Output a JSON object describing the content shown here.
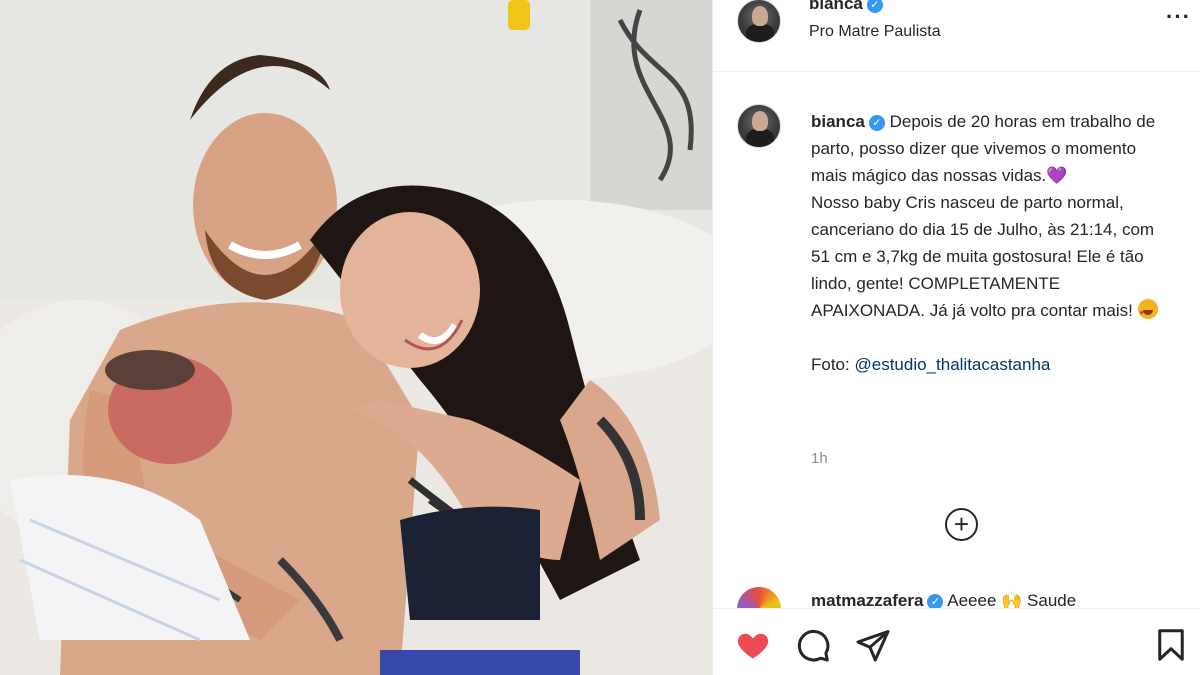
{
  "post": {
    "header": {
      "username": "bianca",
      "location": "Pro Matre Paulista",
      "more_label": "···"
    },
    "caption": {
      "username": "bianca",
      "line1": "Depois de 20 horas em trabalho de parto, posso dizer que vivemos o momento mais mágico das nossas vidas.",
      "heart": "💜",
      "line2": "Nosso baby Cris nasceu de parto normal, canceriano do dia 15 de Julho, às 21:14, com 51 cm e 3,7kg de muita gostosura! Ele é tão lindo, gente! COMPLETAMENTE APAIXONADA. Já já volto pra contar mais!",
      "emoji": "🤩",
      "photo_credit_label": "Foto:",
      "photo_credit_mention": "@estudio_thalitacastanha"
    },
    "timestamp": "1h",
    "load_more_symbol": "+",
    "comment": {
      "username": "matmazzafera",
      "text": "Aeeee 🙌 Saude"
    },
    "icons": {
      "like": "heart-icon",
      "comment": "comment-icon",
      "share": "share-icon",
      "save": "bookmark-icon"
    },
    "colors": {
      "like_active": "#ed4956",
      "verified": "#3897f0",
      "mention": "#00376b",
      "secondary_text": "#8e8e8e"
    }
  }
}
